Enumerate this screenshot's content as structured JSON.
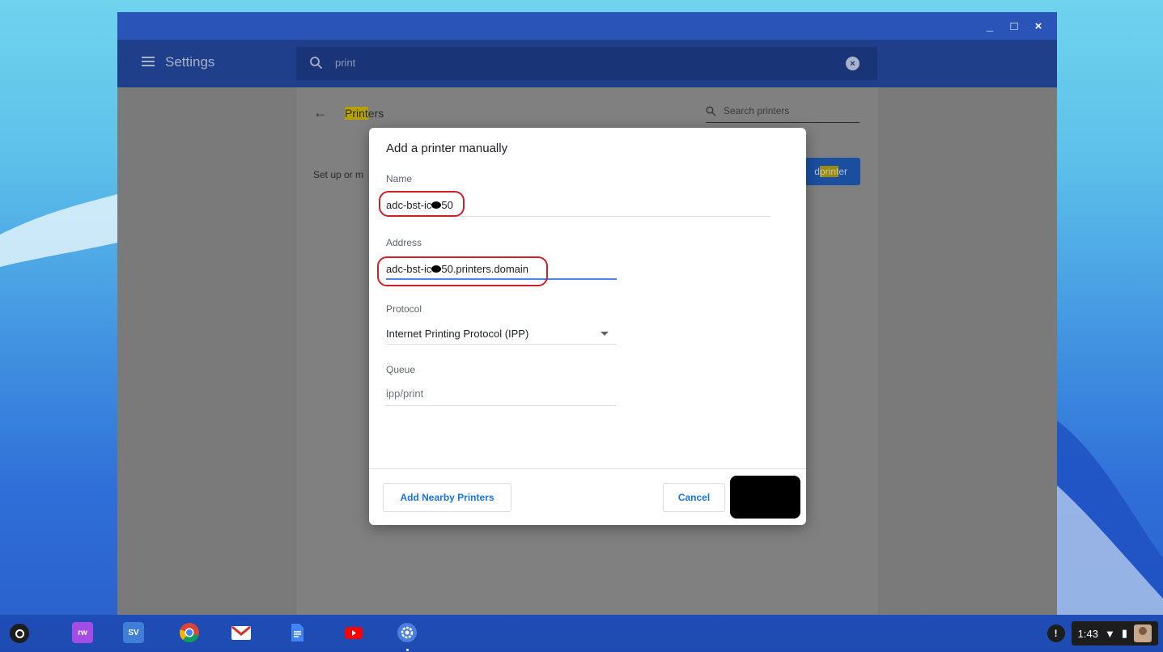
{
  "window": {
    "controls": [
      "_",
      "□",
      "×"
    ]
  },
  "header": {
    "app_title": "Settings",
    "search_value": "print"
  },
  "page": {
    "title_highlight": "Print",
    "title_rest": "ers",
    "search_placeholder": "Search printers",
    "setup_text": "Set up or m",
    "add_button_prefix": "d ",
    "add_button_highlight": "print",
    "add_button_suffix": "er"
  },
  "dialog": {
    "title": "Add a printer manually",
    "name_label": "Name",
    "name_value_pre": "adc-bst-ic",
    "name_value_post": "50",
    "address_label": "Address",
    "address_value_pre": "adc-bst-ic",
    "address_value_post": "50.printers.domain",
    "protocol_label": "Protocol",
    "protocol_value": "Internet Printing Protocol (IPP)",
    "queue_label": "Queue",
    "queue_value": "ipp/print",
    "add_nearby_label": "Add Nearby Printers",
    "cancel_label": "Cancel"
  },
  "shelf": {
    "apps": [
      {
        "name": "rw",
        "color": "#a64ce6"
      },
      {
        "name": "SV",
        "color": "#3f7fd8"
      },
      {
        "name": "chrome",
        "color": "#ffffff"
      },
      {
        "name": "gmail",
        "color": "#ffffff"
      },
      {
        "name": "docs",
        "color": "#4285f4"
      },
      {
        "name": "youtube",
        "color": "#ff0000"
      },
      {
        "name": "settings",
        "color": "#4a7fe0"
      }
    ],
    "time": "1:43"
  },
  "colors": {
    "accent": "#1a73e8",
    "highlight_ring": "#d01f26",
    "title_bar": "#2a54b8"
  }
}
